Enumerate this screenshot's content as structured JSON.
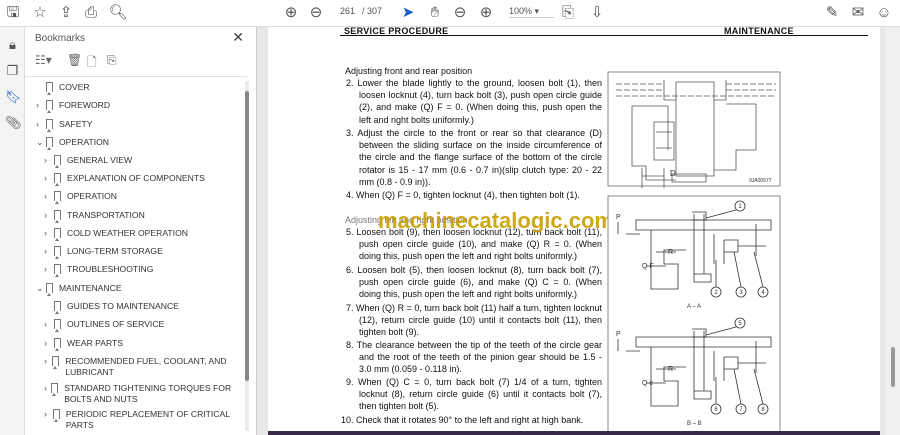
{
  "toolbar": {
    "page_current": "261",
    "page_total": "/ 307",
    "zoom": "100%"
  },
  "bookmarks": {
    "title": "Bookmarks",
    "items": [
      {
        "label": "COVER",
        "level": 0,
        "chevron": "",
        "wrap": false
      },
      {
        "label": "FOREWORD",
        "level": 0,
        "chevron": ">"
      },
      {
        "label": "SAFETY",
        "level": 0,
        "chevron": ">"
      },
      {
        "label": "OPERATION",
        "level": 0,
        "chevron": "v"
      },
      {
        "label": "GENERAL VIEW",
        "level": 1,
        "chevron": ">"
      },
      {
        "label": "EXPLANATION OF COMPONENTS",
        "level": 1,
        "chevron": ">"
      },
      {
        "label": "OPERATION",
        "level": 1,
        "chevron": ">"
      },
      {
        "label": "TRANSPORTATION",
        "level": 1,
        "chevron": ">"
      },
      {
        "label": "COLD WEATHER OPERATION",
        "level": 1,
        "chevron": ">"
      },
      {
        "label": "LONG-TERM STORAGE",
        "level": 1,
        "chevron": ">"
      },
      {
        "label": "TROUBLESHOOTING",
        "level": 1,
        "chevron": ">"
      },
      {
        "label": "MAINTENANCE",
        "level": 0,
        "chevron": "v"
      },
      {
        "label": "GUIDES TO MAINTENANCE",
        "level": 1,
        "chevron": ""
      },
      {
        "label": "OUTLINES OF SERVICE",
        "level": 1,
        "chevron": ">"
      },
      {
        "label": "WEAR PARTS",
        "level": 1,
        "chevron": ">"
      },
      {
        "label": "RECOMMENDED FUEL, COOLANT, AND LUBRICANT",
        "level": 1,
        "chevron": ">"
      },
      {
        "label": "STANDARD TIGHTENING TORQUES FOR BOLTS AND NUTS",
        "level": 1,
        "chevron": ">"
      },
      {
        "label": "PERIODIC REPLACEMENT OF CRITICAL PARTS",
        "level": 1,
        "chevron": ">"
      }
    ]
  },
  "document": {
    "header_left": "SERVICE PROCEDURE",
    "header_right": "MAINTENANCE",
    "heading1": "Adjusting front and rear position",
    "heading2": "Adjusting left and right position",
    "watermark": "machinecatalogic.com",
    "steps": [
      "2. Lower the blade lightly to the ground, loosen bolt (1), then loosen locknut (4), turn back bolt (3), push open circle guide (2), and make (Q) F = 0.  (When doing this, push open the left and right bolts uniformly.)",
      "3. Adjust the circle to the front or rear so that clearance (D) between the sliding surface on the inside circumference of the circle and the flange surface of the bottom of the circle rotator is 15 - 17 mm (0.6 - 0.7 in)(slip clutch type: 20 - 22 mm (0.8 - 0.9 in)).",
      "4. When (Q) F = 0, tighten locknut (4), then tighten bolt (1).",
      "5. Loosen bolt (9), then loosen locknut (12), turn back bolt (11), push open circle guide (10), and make (Q) R = 0.  (When doing this, push open the left and right bolts uniformly.)",
      "6. Loosen bolt (5), then loosen locknut (8), turn back bolt (7), push open circle guide (6), and make (Q) C = 0.  (When doing this, push open the left and right bolts uniformly.)",
      "7. When (Q) R = 0, turn back bolt (11) half a turn, tighten locknut (12), return circle guide (10) until it contacts bolt (11), then tighten bolt (9).",
      "8. The clearance between the tip of the teeth of the circle gear and the root of the teeth of the pinion gear should be 1.5 - 3.0 mm (0.059 - 0.118 in).",
      "9. When (Q) C = 0, turn back bolt (7) 1/4 of a turn, tighten locknut (8), return circle guide (6) until it contacts bolt (7), then tighten bolt (5).",
      "10. Check that it rotates 90° to the left and right at high bank."
    ],
    "fig1": {
      "dim": "D",
      "code": "9JA00577"
    },
    "fig2": {
      "p": "P",
      "r": "R",
      "qf": "Q F",
      "qc": "Q c",
      "section_a": "A – A",
      "section_b": "B – B",
      "callouts_a": [
        "1",
        "2",
        "3",
        "4"
      ],
      "callouts_b": [
        "5",
        "6",
        "7",
        "8"
      ]
    }
  }
}
